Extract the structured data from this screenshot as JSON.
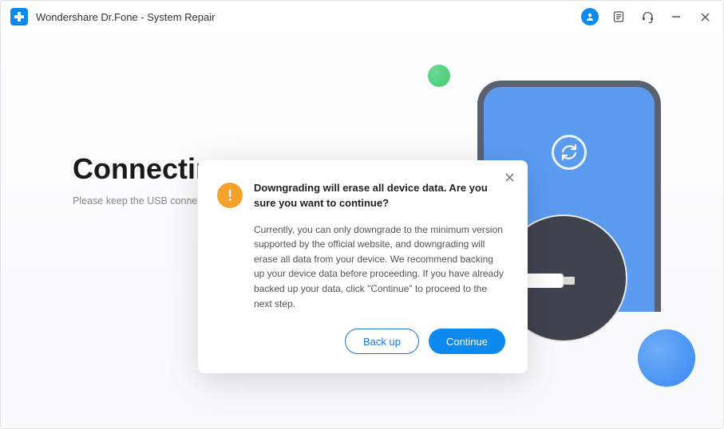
{
  "app": {
    "title": "Wondershare Dr.Fone - System Repair"
  },
  "main": {
    "heading": "Connecting...",
    "sub": "Please keep the USB connection"
  },
  "modal": {
    "title": "Downgrading will erase all device data. Are you sure you want to continue?",
    "body": "Currently, you can only downgrade to the minimum version supported by the official website, and downgrading will erase all data from your device. We recommend backing up your device data before proceeding. If you have already backed up your data, click \"Continue\" to proceed to the next step.",
    "backup_label": "Back up",
    "continue_label": "Continue"
  }
}
